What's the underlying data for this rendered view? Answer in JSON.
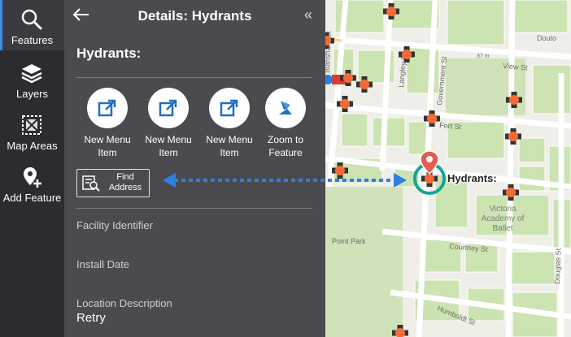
{
  "rail": {
    "items": [
      {
        "label": "Features",
        "icon": "search-icon"
      },
      {
        "label": "Layers",
        "icon": "layers-icon"
      },
      {
        "label": "Map Areas",
        "icon": "map-areas-icon"
      },
      {
        "label": "Add Feature",
        "icon": "add-feature-icon"
      }
    ]
  },
  "panel": {
    "title": "Details: Hydrants",
    "feature_title": "Hydrants:",
    "menu_buttons": [
      {
        "label": "New Menu Item",
        "icon": "open-external-icon"
      },
      {
        "label": "New Menu Item",
        "icon": "open-external-icon"
      },
      {
        "label": "New Menu Item",
        "icon": "open-external-icon"
      },
      {
        "label": "Zoom to Feature",
        "icon": "zoom-to-feature-icon"
      }
    ],
    "find_address": "Find Address",
    "fields": [
      {
        "label": "Facility Identifier",
        "value": ""
      },
      {
        "label": "Install Date",
        "value": ""
      },
      {
        "label": "Location Description",
        "value": "Retry"
      }
    ]
  },
  "map": {
    "callout": "Hydrants:",
    "street_labels": [
      "View St",
      "Fort St",
      "Courtney St",
      "Humboldt St",
      "Government St",
      "Langley St",
      "Douglas St",
      "Blanshard St",
      "Douto",
      "Point Park",
      "37 m"
    ],
    "poi": [
      "Victoria",
      "Academy of",
      "Ballet"
    ],
    "colors": {
      "accent": "#3a8ee6",
      "hydrant": "#f46a35",
      "pin": "#e45b4f",
      "selection": "#15a39a"
    }
  }
}
